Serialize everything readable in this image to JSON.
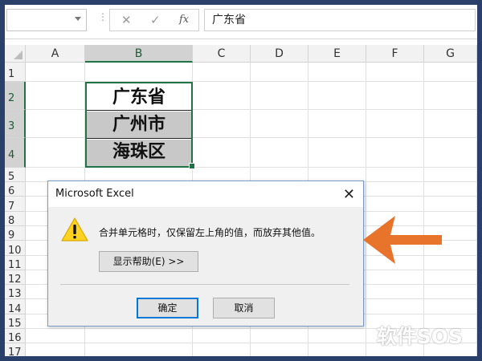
{
  "formula_bar": {
    "name_box_value": "",
    "cancel_icon": "✕",
    "enter_icon": "✓",
    "fx_label": "fx",
    "formula_value": "广东省"
  },
  "columns": [
    "A",
    "B",
    "C",
    "D",
    "E",
    "F",
    "G"
  ],
  "selected_column": "B",
  "rows": [
    "1",
    "2",
    "3",
    "4",
    "5",
    "6",
    "7",
    "8",
    "9",
    "10",
    "11",
    "12",
    "13",
    "14",
    "15",
    "16",
    "17"
  ],
  "selected_rows": [
    "2",
    "3",
    "4"
  ],
  "cells": [
    "广东省",
    "广州市",
    "海珠区"
  ],
  "dialog": {
    "title": "Microsoft Excel",
    "message": "合并单元格时，仅保留左上角的值，而放弃其他值。",
    "help_button": "显示帮助(E) >>",
    "ok_button": "确定",
    "cancel_button": "取消",
    "icon": "warning-icon"
  },
  "annotation": {
    "arrow_color": "#e8732a"
  },
  "watermark": "软件SOS",
  "colors": {
    "excel_green": "#217346",
    "frame": "#2a3f6a",
    "selected_fill": "#c8c8c8"
  }
}
